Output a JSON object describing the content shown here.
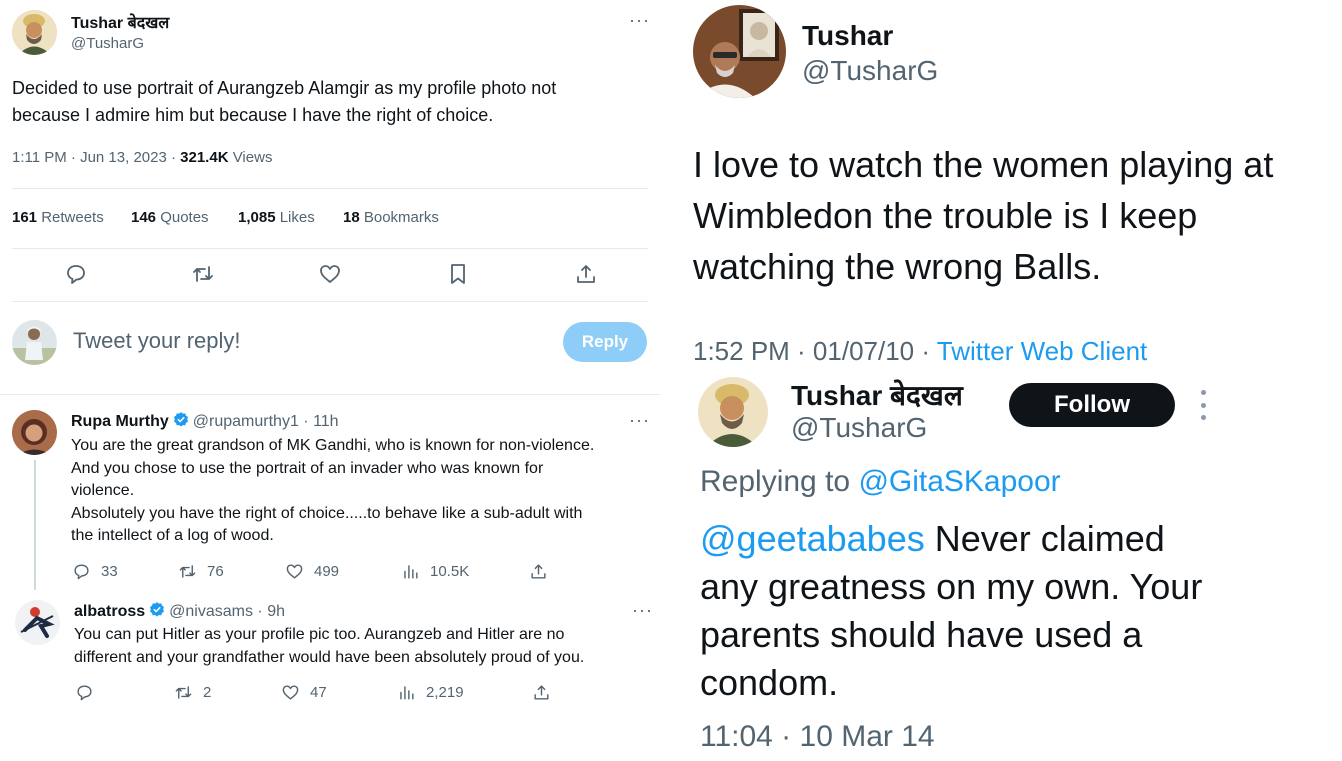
{
  "left_tweet": {
    "author": {
      "name": "Tushar बेदखल",
      "handle": "@TusharG"
    },
    "more": "···",
    "text_line1": "Decided to use portrait of Aurangzeb Alamgir as my profile photo not",
    "text_line2": "because I admire him but because I have the right of choice.",
    "time": "1:11 PM · Jun 13, 2023 · ",
    "views_count": "321.4K",
    "views_label": " Views",
    "stats": [
      {
        "count": "161",
        "label": " Retweets"
      },
      {
        "count": "146",
        "label": " Quotes"
      },
      {
        "count": "1,085",
        "label": " Likes"
      },
      {
        "count": "18",
        "label": " Bookmarks"
      }
    ],
    "reply_placeholder": "Tweet your reply!",
    "reply_button": "Reply"
  },
  "replies": [
    {
      "name": "Rupa Murthy",
      "handle": "@rupamurthy1",
      "time": " · 11h",
      "more": "···",
      "lines": [
        "You are the great grandson of MK Gandhi, who is known for non-violence.",
        "And you chose to use the portrait of an invader who was known for",
        "violence.",
        "Absolutely you have the right of choice.....to behave like a sub-adult with",
        "the intellect of a log of wood."
      ],
      "actions": {
        "replies": "33",
        "retweets": "76",
        "likes": "499",
        "views": "10.5K"
      }
    },
    {
      "name": "albatross",
      "handle": "@nivasams",
      "time": " · 9h",
      "more": "···",
      "lines": [
        "You can put Hitler as your profile pic too. Aurangzeb and Hitler are no",
        "different and your grandfather would have been absolutely proud of you."
      ],
      "actions": {
        "replies": "",
        "retweets": "2",
        "likes": "47",
        "views": "2,219"
      }
    }
  ],
  "right_top": {
    "name": "Tushar",
    "handle": "@TusharG",
    "lines": [
      "I love to watch the women playing at",
      "Wimbledon the trouble is I keep",
      "watching the wrong Balls."
    ],
    "meta": "1:52 PM · 01/07/10 · ",
    "client": "Twitter Web Client"
  },
  "right_bottom": {
    "name": "Tushar बेदखल",
    "handle": "@TusharG",
    "follow": "Follow",
    "replying_label": "Replying to ",
    "replying_to": "@GitaSKapoor",
    "mention": "@geetababes",
    "line1_rest": " Never claimed",
    "lines": [
      "any greatness on my own. Your",
      "parents should have used a",
      "condom."
    ],
    "meta": "11:04 · 10 Mar 14"
  },
  "colors": {
    "accent": "#1d9bf0",
    "text": "#0f1419",
    "muted": "#536471",
    "verified": "#1d9bf0"
  }
}
